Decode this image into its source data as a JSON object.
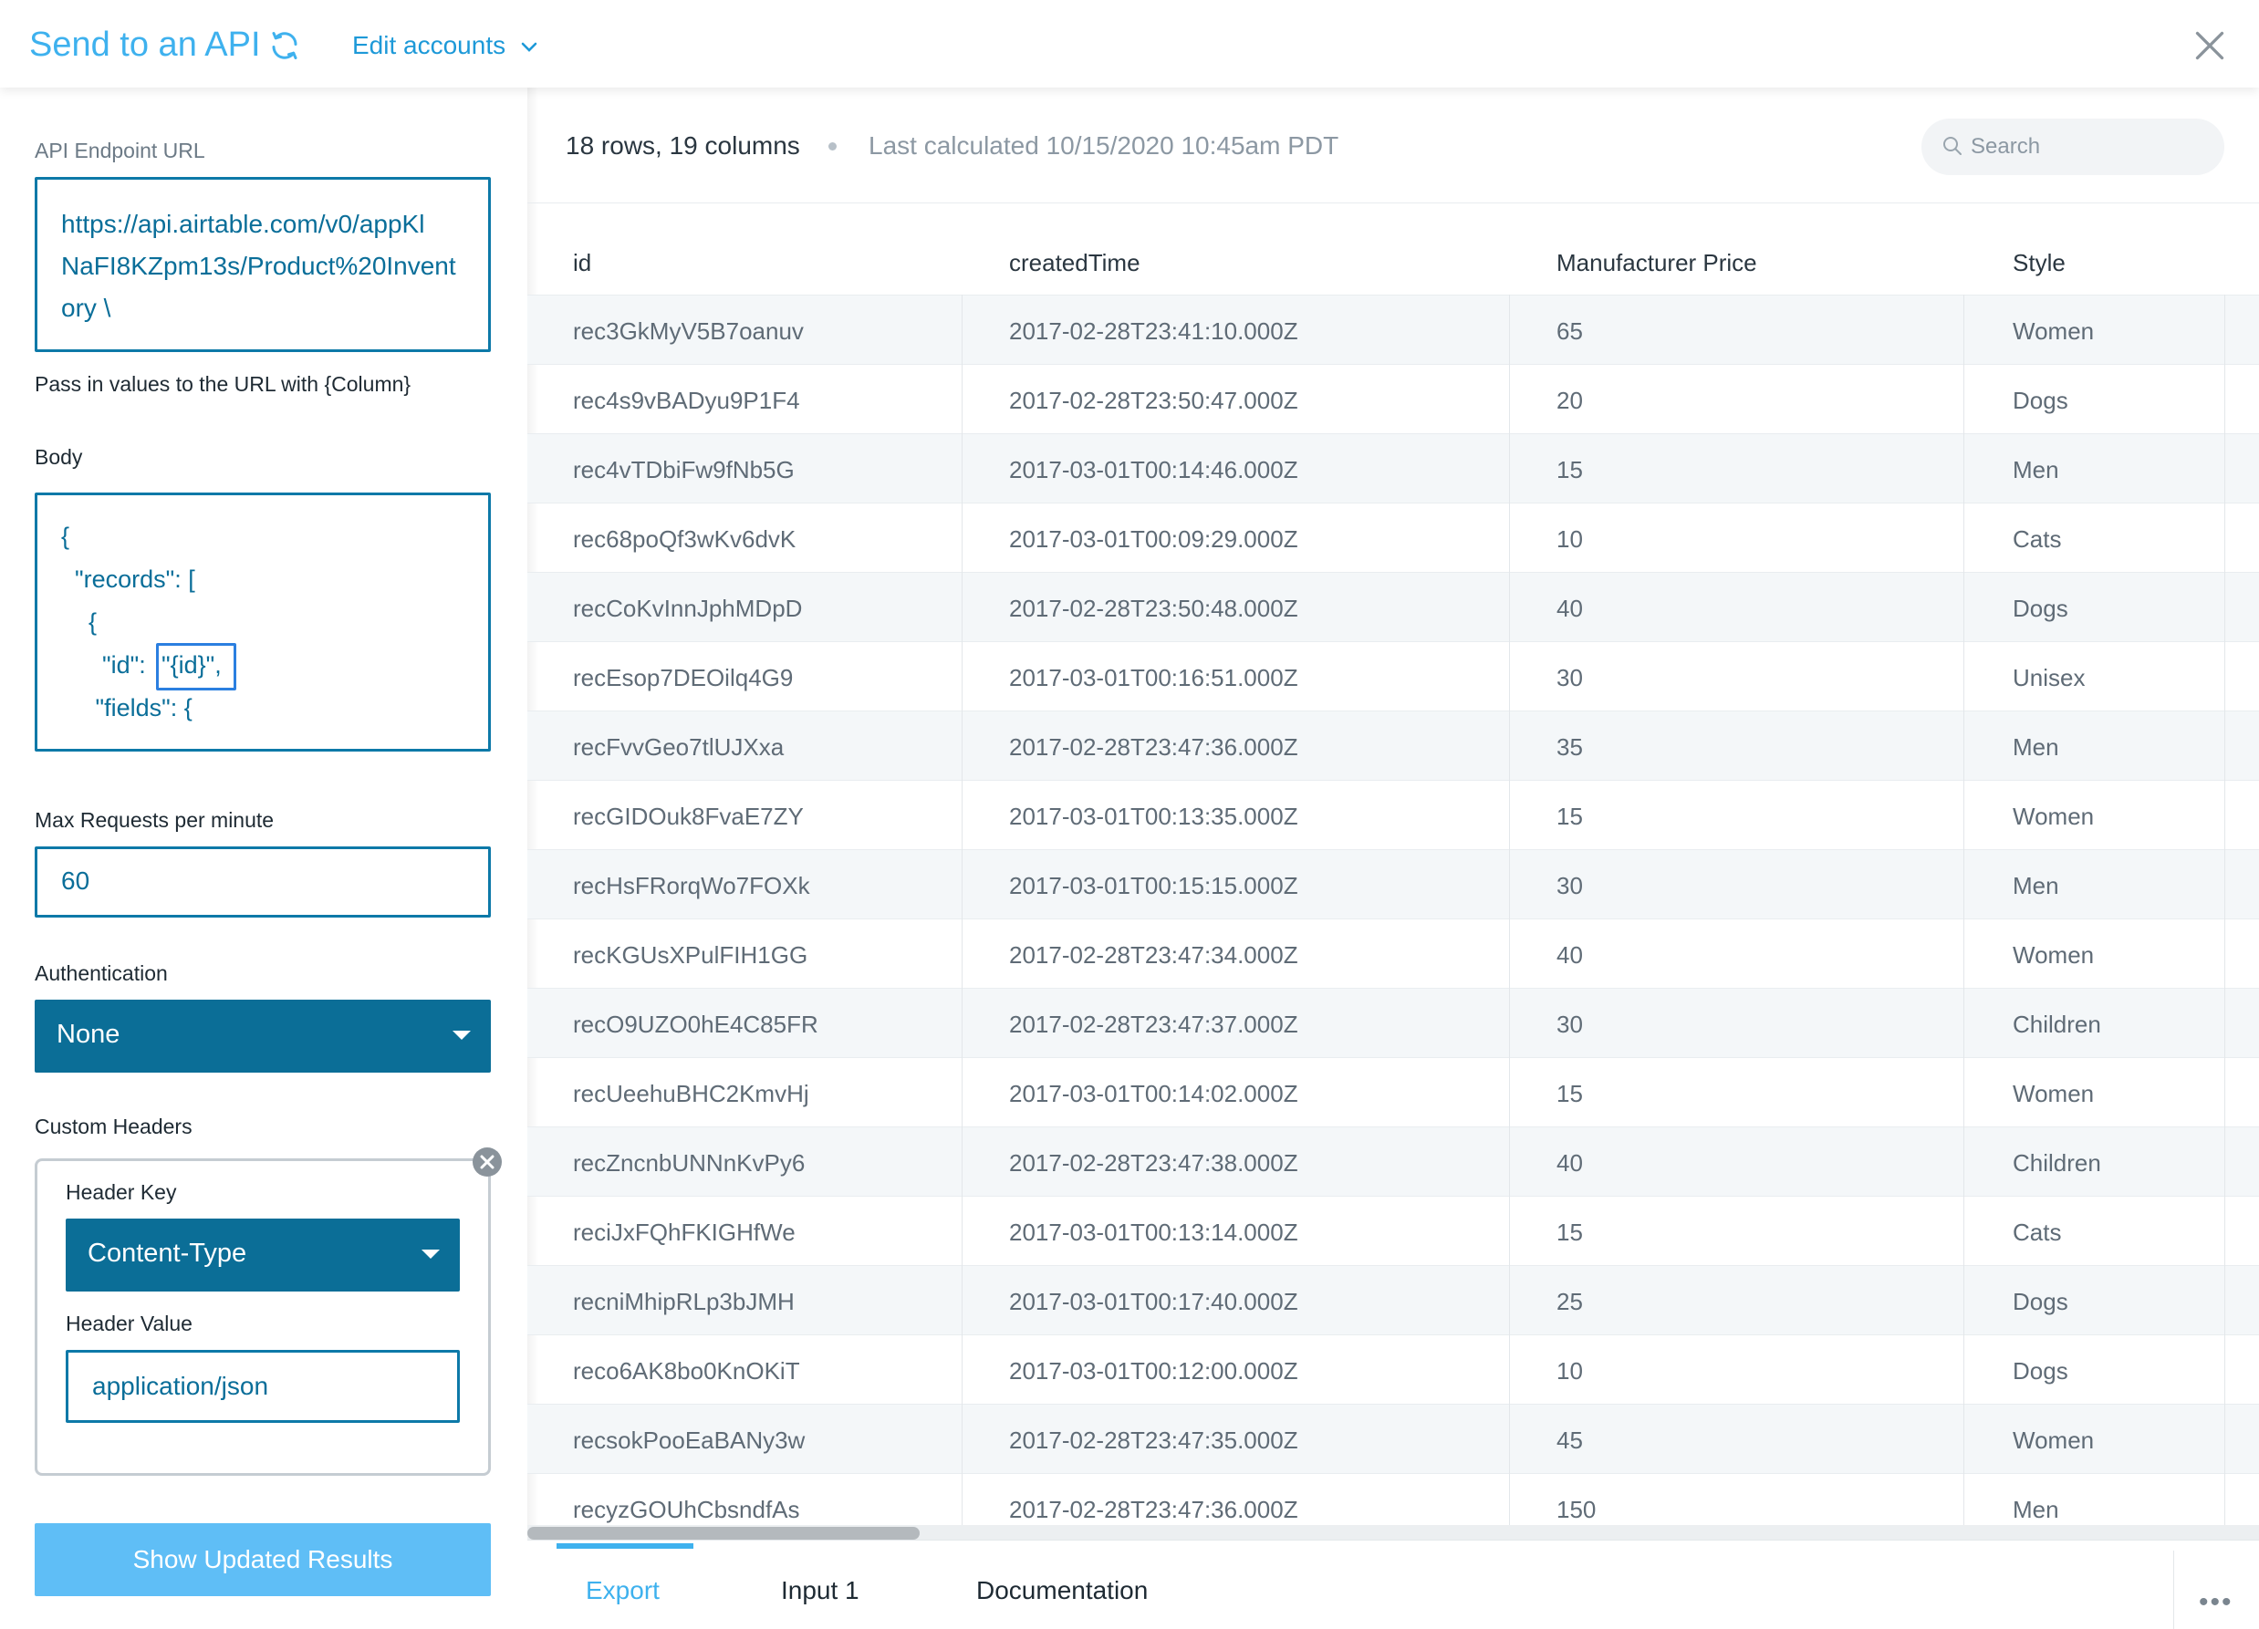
{
  "header": {
    "title": "Send to an API",
    "edit_accounts": "Edit accounts"
  },
  "form": {
    "endpoint_label": "API Endpoint URL",
    "endpoint_lines": [
      "https://api.airtable.com/v0/appKl",
      "NaFI8KZpm13s/Product%20Invent",
      "ory \\"
    ],
    "endpoint_help": "Pass in values to the URL with {Column}",
    "body_label": "Body",
    "body_lines": [
      "{",
      "  \"records\": [",
      "    {",
      "      \"id\": ",
      "\"{id}\",",
      "     \"fields\": {"
    ],
    "max_requests_label": "Max Requests per minute",
    "max_requests_value": "60",
    "auth_label": "Authentication",
    "auth_value": "None",
    "custom_headers_label": "Custom Headers",
    "header_key_label": "Header Key",
    "header_key_value": "Content-Type",
    "header_value_label": "Header Value",
    "header_value_value": "application/json",
    "show_results_button": "Show Updated Results"
  },
  "results": {
    "summary": "18 rows, 19 columns",
    "last_calculated": "Last calculated 10/15/2020 10:45am PDT",
    "search_placeholder": "Search",
    "columns": [
      "id",
      "createdTime",
      "Manufacturer Price",
      "Style"
    ],
    "rows": [
      [
        "rec3GkMyV5B7oanuv",
        "2017-02-28T23:41:10.000Z",
        "65",
        "Women"
      ],
      [
        "rec4s9vBADyu9P1F4",
        "2017-02-28T23:50:47.000Z",
        "20",
        "Dogs"
      ],
      [
        "rec4vTDbiFw9fNb5G",
        "2017-03-01T00:14:46.000Z",
        "15",
        "Men"
      ],
      [
        "rec68poQf3wKv6dvK",
        "2017-03-01T00:09:29.000Z",
        "10",
        "Cats"
      ],
      [
        "recCoKvInnJphMDpD",
        "2017-02-28T23:50:48.000Z",
        "40",
        "Dogs"
      ],
      [
        "recEsop7DEOilq4G9",
        "2017-03-01T00:16:51.000Z",
        "30",
        "Unisex"
      ],
      [
        "recFvvGeo7tlUJXxa",
        "2017-02-28T23:47:36.000Z",
        "35",
        "Men"
      ],
      [
        "recGIDOuk8FvaE7ZY",
        "2017-03-01T00:13:35.000Z",
        "15",
        "Women"
      ],
      [
        "recHsFRorqWo7FOXk",
        "2017-03-01T00:15:15.000Z",
        "30",
        "Men"
      ],
      [
        "recKGUsXPulFIH1GG",
        "2017-02-28T23:47:34.000Z",
        "40",
        "Women"
      ],
      [
        "recO9UZO0hE4C85FR",
        "2017-02-28T23:47:37.000Z",
        "30",
        "Children"
      ],
      [
        "recUeehuBHC2KmvHj",
        "2017-03-01T00:14:02.000Z",
        "15",
        "Women"
      ],
      [
        "recZncnbUNNnKvPy6",
        "2017-02-28T23:47:38.000Z",
        "40",
        "Children"
      ],
      [
        "reciJxFQhFKIGHfWe",
        "2017-03-01T00:13:14.000Z",
        "15",
        "Cats"
      ],
      [
        "recniMhipRLp3bJMH",
        "2017-03-01T00:17:40.000Z",
        "25",
        "Dogs"
      ],
      [
        "reco6AK8bo0KnOKiT",
        "2017-03-01T00:12:00.000Z",
        "10",
        "Dogs"
      ],
      [
        "recsokPooEaBANy3w",
        "2017-02-28T23:47:35.000Z",
        "45",
        "Women"
      ],
      [
        "recyzGOUhCbsndfAs",
        "2017-02-28T23:47:36.000Z",
        "150",
        "Men"
      ]
    ]
  },
  "tabs": [
    "Export",
    "Input 1",
    "Documentation"
  ],
  "more_label": "•••",
  "colors": {
    "accent": "#3eb1ee",
    "select_bg": "#0b6e97",
    "button_bg": "#5fbef6"
  },
  "icons": [
    "refresh-icon",
    "chevron-down-icon",
    "close-icon",
    "search-icon",
    "caret-down-icon",
    "remove-icon",
    "more-icon"
  ]
}
